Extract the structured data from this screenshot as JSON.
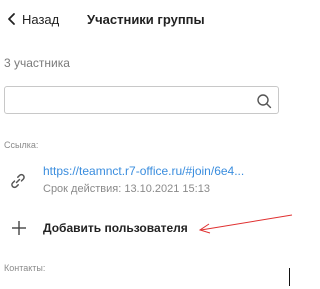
{
  "header": {
    "back_label": "Назад",
    "title": "Участники группы"
  },
  "members": {
    "count_label": "3 участника"
  },
  "search": {
    "value": "",
    "placeholder": ""
  },
  "link_section": {
    "label": "Ссылка:",
    "url": "https://teamnct.r7-office.ru/#join/6e4...",
    "expiry": "Срок действия: 13.10.2021 15:13"
  },
  "add_user": {
    "label": "Добавить пользователя"
  },
  "contacts_section": {
    "label": "Контакты:"
  },
  "colors": {
    "link": "#3a8dde",
    "annotation_arrow": "#e03030",
    "muted_text": "#8a8a8a"
  },
  "icons": {
    "back": "chevron-left-icon",
    "search": "search-icon",
    "link": "chain-link-icon",
    "add": "plus-icon"
  }
}
